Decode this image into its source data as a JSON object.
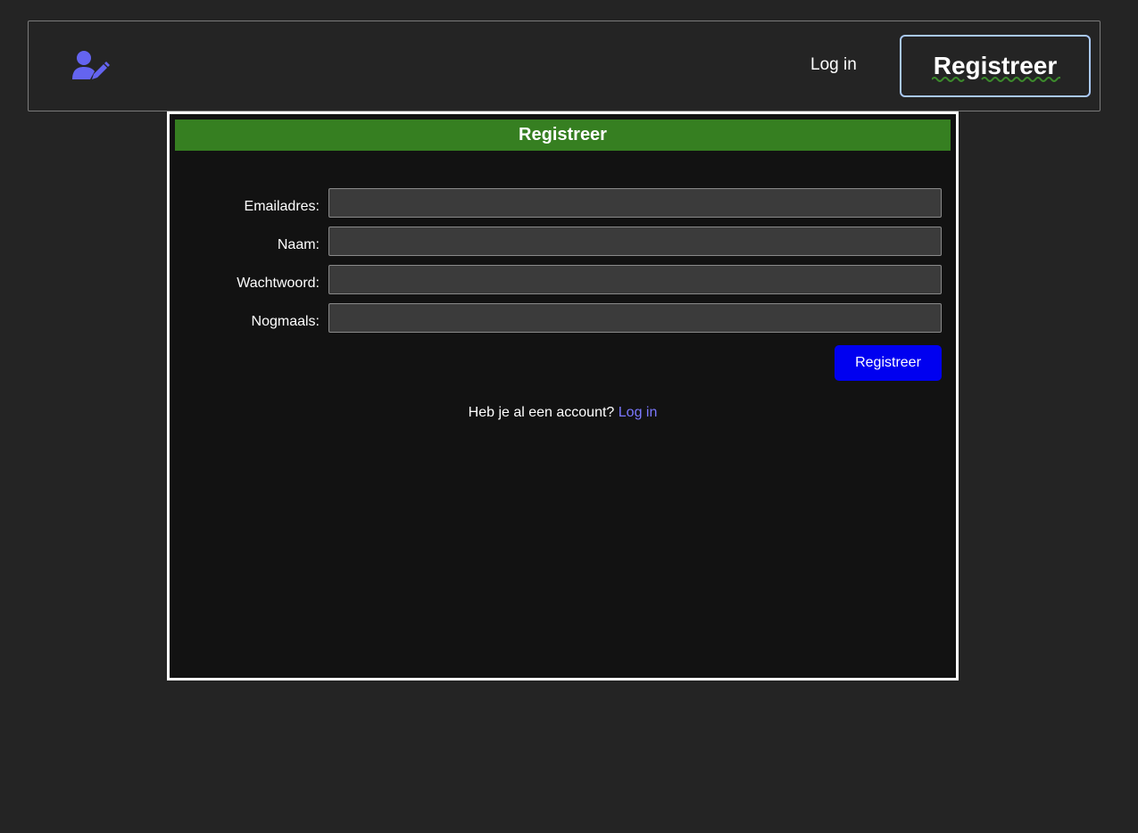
{
  "nav": {
    "logo_icon": "user-edit-icon",
    "login_label": "Log in",
    "register_label": "Registreer"
  },
  "colors": {
    "accent_icon": "#6464f0",
    "header_green": "#367f21",
    "submit_blue": "#0000f0",
    "link_color": "#7b78ff"
  },
  "form": {
    "title": "Registreer",
    "fields": [
      {
        "label": "Emailadres:",
        "value": ""
      },
      {
        "label": "Naam:",
        "value": ""
      },
      {
        "label": "Wachtwoord:",
        "value": ""
      },
      {
        "label": "Nogmaals:",
        "value": ""
      }
    ],
    "submit_label": "Registreer",
    "footer_text": "Heb je al een account?",
    "footer_link": "Log in"
  }
}
